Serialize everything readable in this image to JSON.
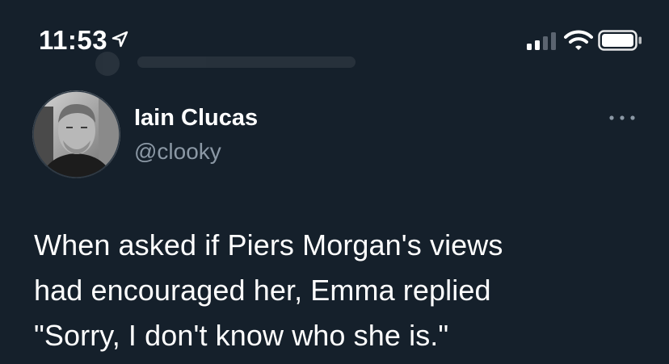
{
  "status_bar": {
    "time": "11:53",
    "location_icon": "location-arrow-icon",
    "signal_icon": "cellular-signal-icon",
    "wifi_icon": "wifi-icon",
    "battery_icon": "battery-icon"
  },
  "tweet": {
    "author": {
      "display_name": "Iain Clucas",
      "handle": "@clooky",
      "avatar_icon": "avatar"
    },
    "text": "When asked if Piers Morgan's views\nhad encouraged her, Emma replied\n\"Sorry, I don't know who she is.\"",
    "more_icon": "more-horizontal-icon"
  },
  "colors": {
    "background": "#15202b",
    "primary_text": "#ffffff",
    "secondary_text": "#8b98a5"
  }
}
